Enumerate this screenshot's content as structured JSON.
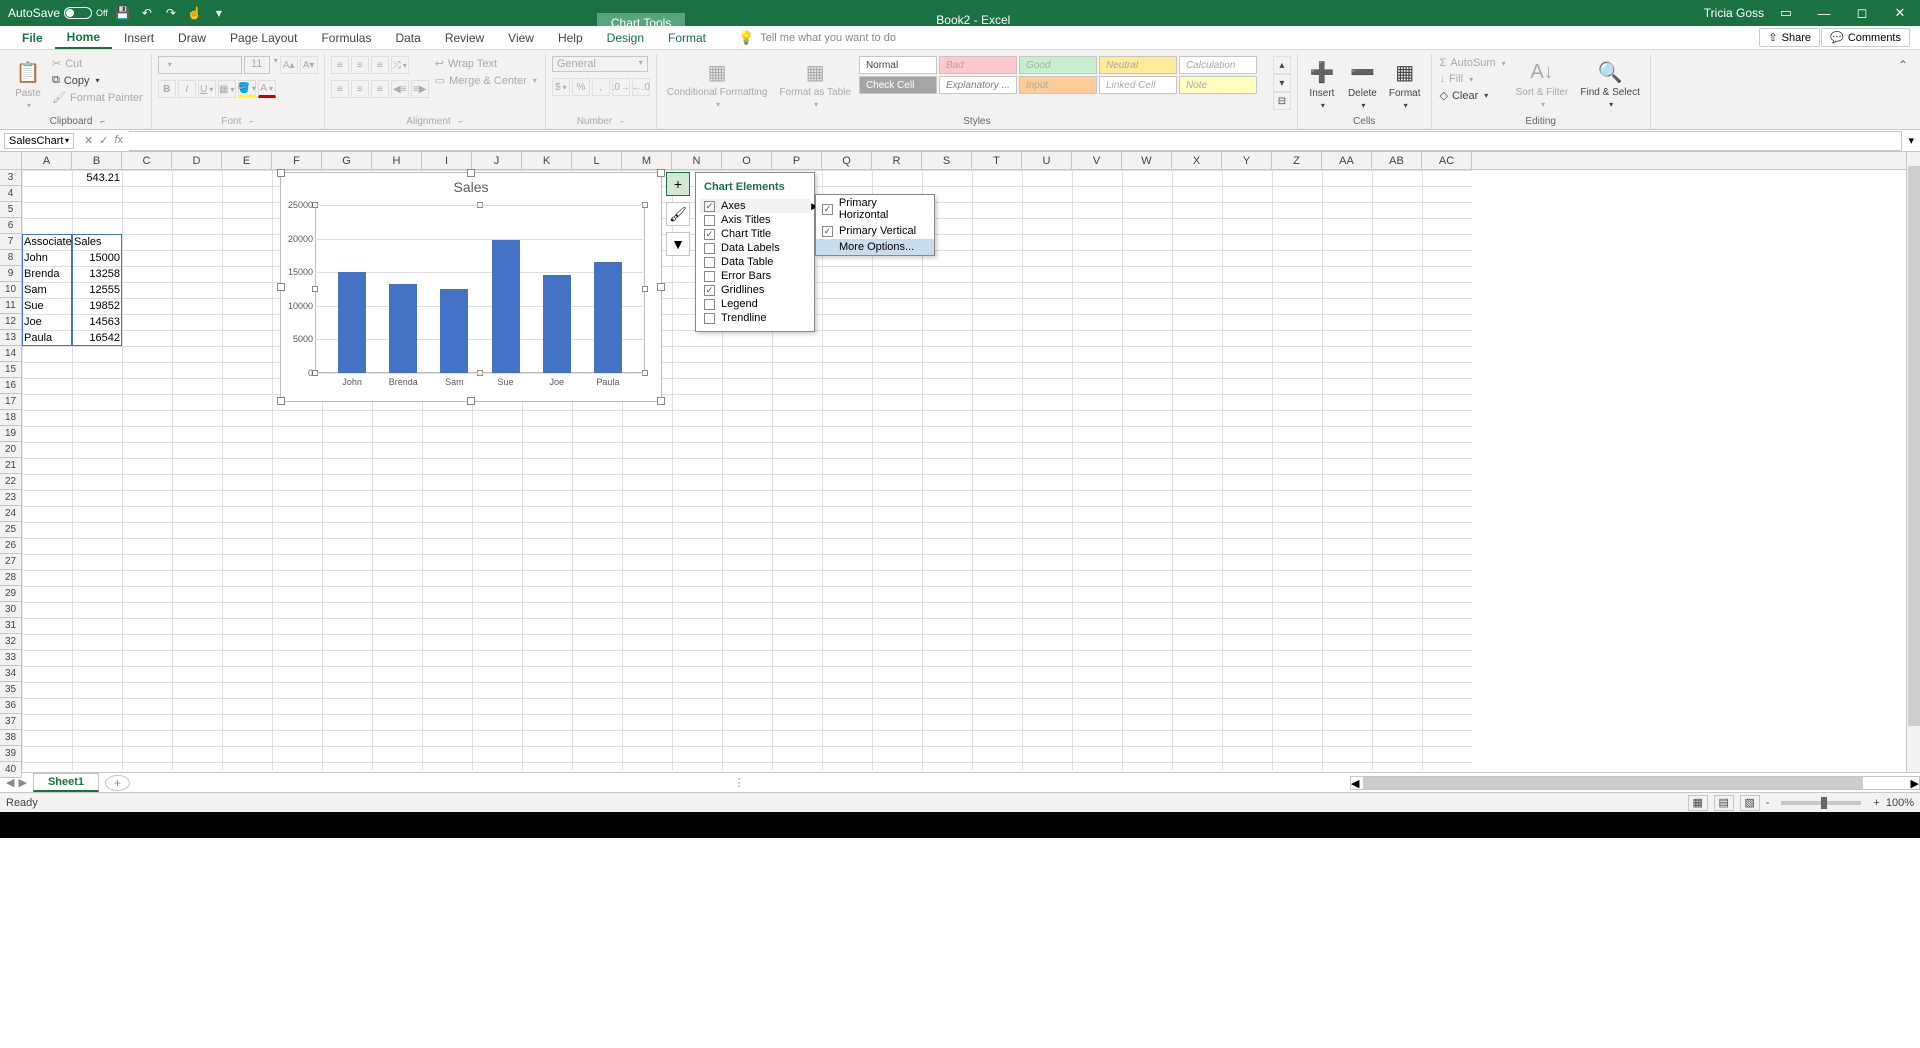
{
  "titlebar": {
    "autosave_label": "AutoSave",
    "autosave_state": "Off",
    "chart_tools": "Chart Tools",
    "book": "Book2  -  Excel",
    "user": "Tricia Goss"
  },
  "tabs": {
    "file": "File",
    "home": "Home",
    "insert": "Insert",
    "draw": "Draw",
    "pagelayout": "Page Layout",
    "formulas": "Formulas",
    "data": "Data",
    "review": "Review",
    "view": "View",
    "help": "Help",
    "design": "Design",
    "format": "Format",
    "tellme_placeholder": "Tell me what you want to do",
    "share": "Share",
    "comments": "Comments"
  },
  "ribbon": {
    "clipboard": {
      "paste": "Paste",
      "cut": "Cut",
      "copy": "Copy",
      "fmtpainter": "Format Painter",
      "label": "Clipboard"
    },
    "font": {
      "size": "11",
      "label": "Font"
    },
    "alignment": {
      "wrap": "Wrap Text",
      "merge": "Merge & Center",
      "label": "Alignment"
    },
    "number": {
      "general": "General",
      "label": "Number"
    },
    "styles": {
      "condfmt": "Conditional Formatting",
      "fmtas": "Format as Table",
      "normal": "Normal",
      "bad": "Bad",
      "good": "Good",
      "neutral": "Neutral",
      "calc": "Calculation",
      "check": "Check Cell",
      "explan": "Explanatory ...",
      "input": "Input",
      "linked": "Linked Cell",
      "note": "Note",
      "label": "Styles"
    },
    "cells": {
      "insert": "Insert",
      "delete": "Delete",
      "format": "Format",
      "label": "Cells"
    },
    "editing": {
      "autosum": "AutoSum",
      "fill": "Fill",
      "clear": "Clear",
      "sort": "Sort & Filter",
      "find": "Find & Select",
      "label": "Editing"
    }
  },
  "namebox": "SalesChart",
  "columns": [
    "A",
    "B",
    "C",
    "D",
    "E",
    "F",
    "G",
    "H",
    "I",
    "J",
    "K",
    "L",
    "M",
    "N",
    "O",
    "P",
    "Q",
    "R",
    "S",
    "T",
    "U",
    "V",
    "W",
    "X",
    "Y",
    "Z",
    "AA",
    "AB",
    "AC"
  ],
  "rows_start": 3,
  "rows_end": 40,
  "cells": {
    "b3": "543.21",
    "a7": "Associate",
    "b7": "Sales",
    "a8": "John",
    "b8": "15000",
    "a9": "Brenda",
    "b9": "13258",
    "a10": "Sam",
    "b10": "12555",
    "a11": "Sue",
    "b11": "19852",
    "a12": "Joe",
    "b12": "14563",
    "a13": "Paula",
    "b13": "16542"
  },
  "chart_data": {
    "type": "bar",
    "title": "Sales",
    "categories": [
      "John",
      "Brenda",
      "Sam",
      "Sue",
      "Joe",
      "Paula"
    ],
    "values": [
      15000,
      13258,
      12555,
      19852,
      14563,
      16542
    ],
    "ylim": [
      0,
      25000
    ],
    "yticks": [
      0,
      5000,
      10000,
      15000,
      20000,
      25000
    ],
    "xlabel": "",
    "ylabel": ""
  },
  "chart_elements": {
    "title": "Chart Elements",
    "items": [
      {
        "label": "Axes",
        "checked": true,
        "hov": true
      },
      {
        "label": "Axis Titles",
        "checked": false
      },
      {
        "label": "Chart Title",
        "checked": true
      },
      {
        "label": "Data Labels",
        "checked": false
      },
      {
        "label": "Data Table",
        "checked": false
      },
      {
        "label": "Error Bars",
        "checked": false
      },
      {
        "label": "Gridlines",
        "checked": true
      },
      {
        "label": "Legend",
        "checked": false
      },
      {
        "label": "Trendline",
        "checked": false
      }
    ],
    "sub": [
      {
        "label": "Primary Horizontal",
        "checked": true
      },
      {
        "label": "Primary Vertical",
        "checked": true
      },
      {
        "label": "More Options...",
        "checked": false,
        "sel": true
      }
    ]
  },
  "sheet_tab": "Sheet1",
  "status": "Ready",
  "zoom": "100%"
}
